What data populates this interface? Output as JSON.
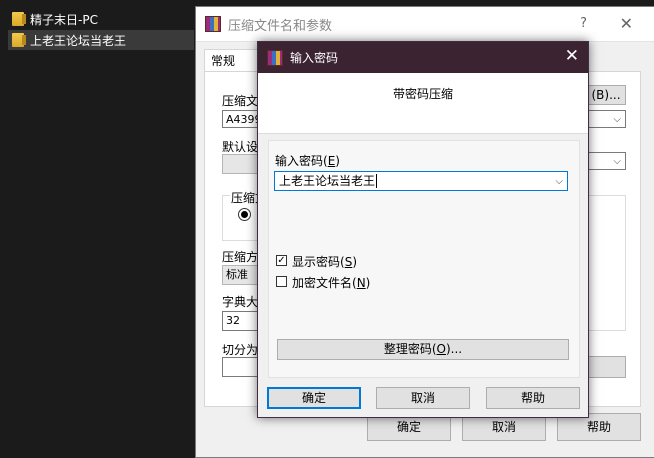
{
  "explorer": {
    "items": [
      {
        "label": "精子末日-PC",
        "selected": false
      },
      {
        "label": "上老王论坛当老王",
        "selected": true
      }
    ]
  },
  "back_dialog": {
    "title": "压缩文件名和参数",
    "help_glyph": "?",
    "close_glyph": "✕",
    "tab_label": "常规",
    "archive_name_label": "压缩文",
    "archive_name_value": "A4399",
    "browse_label": "(B)...",
    "default_label": "默认设",
    "format_label": "压缩文",
    "method_label": "压缩方",
    "method_value": "标准",
    "dict_label": "字典大",
    "dict_value": "32",
    "split_label": "切分为",
    "ok": "确定",
    "cancel": "取消",
    "help": "帮助"
  },
  "front_dialog": {
    "title": "输入密码",
    "close_glyph": "✕",
    "header": "带密码压缩",
    "password_label": "输入密码(",
    "password_key": "E",
    "password_value": "上老王论坛当老王",
    "show_password_label": "显示密码(",
    "show_password_key": "S",
    "show_password_checked": true,
    "encrypt_names_label": "加密文件名(",
    "encrypt_names_key": "N",
    "encrypt_names_checked": false,
    "organize_label": "整理密码(",
    "organize_key": "O",
    "organize_suffix": ")...",
    "ok": "确定",
    "cancel": "取消",
    "help": "帮助"
  }
}
